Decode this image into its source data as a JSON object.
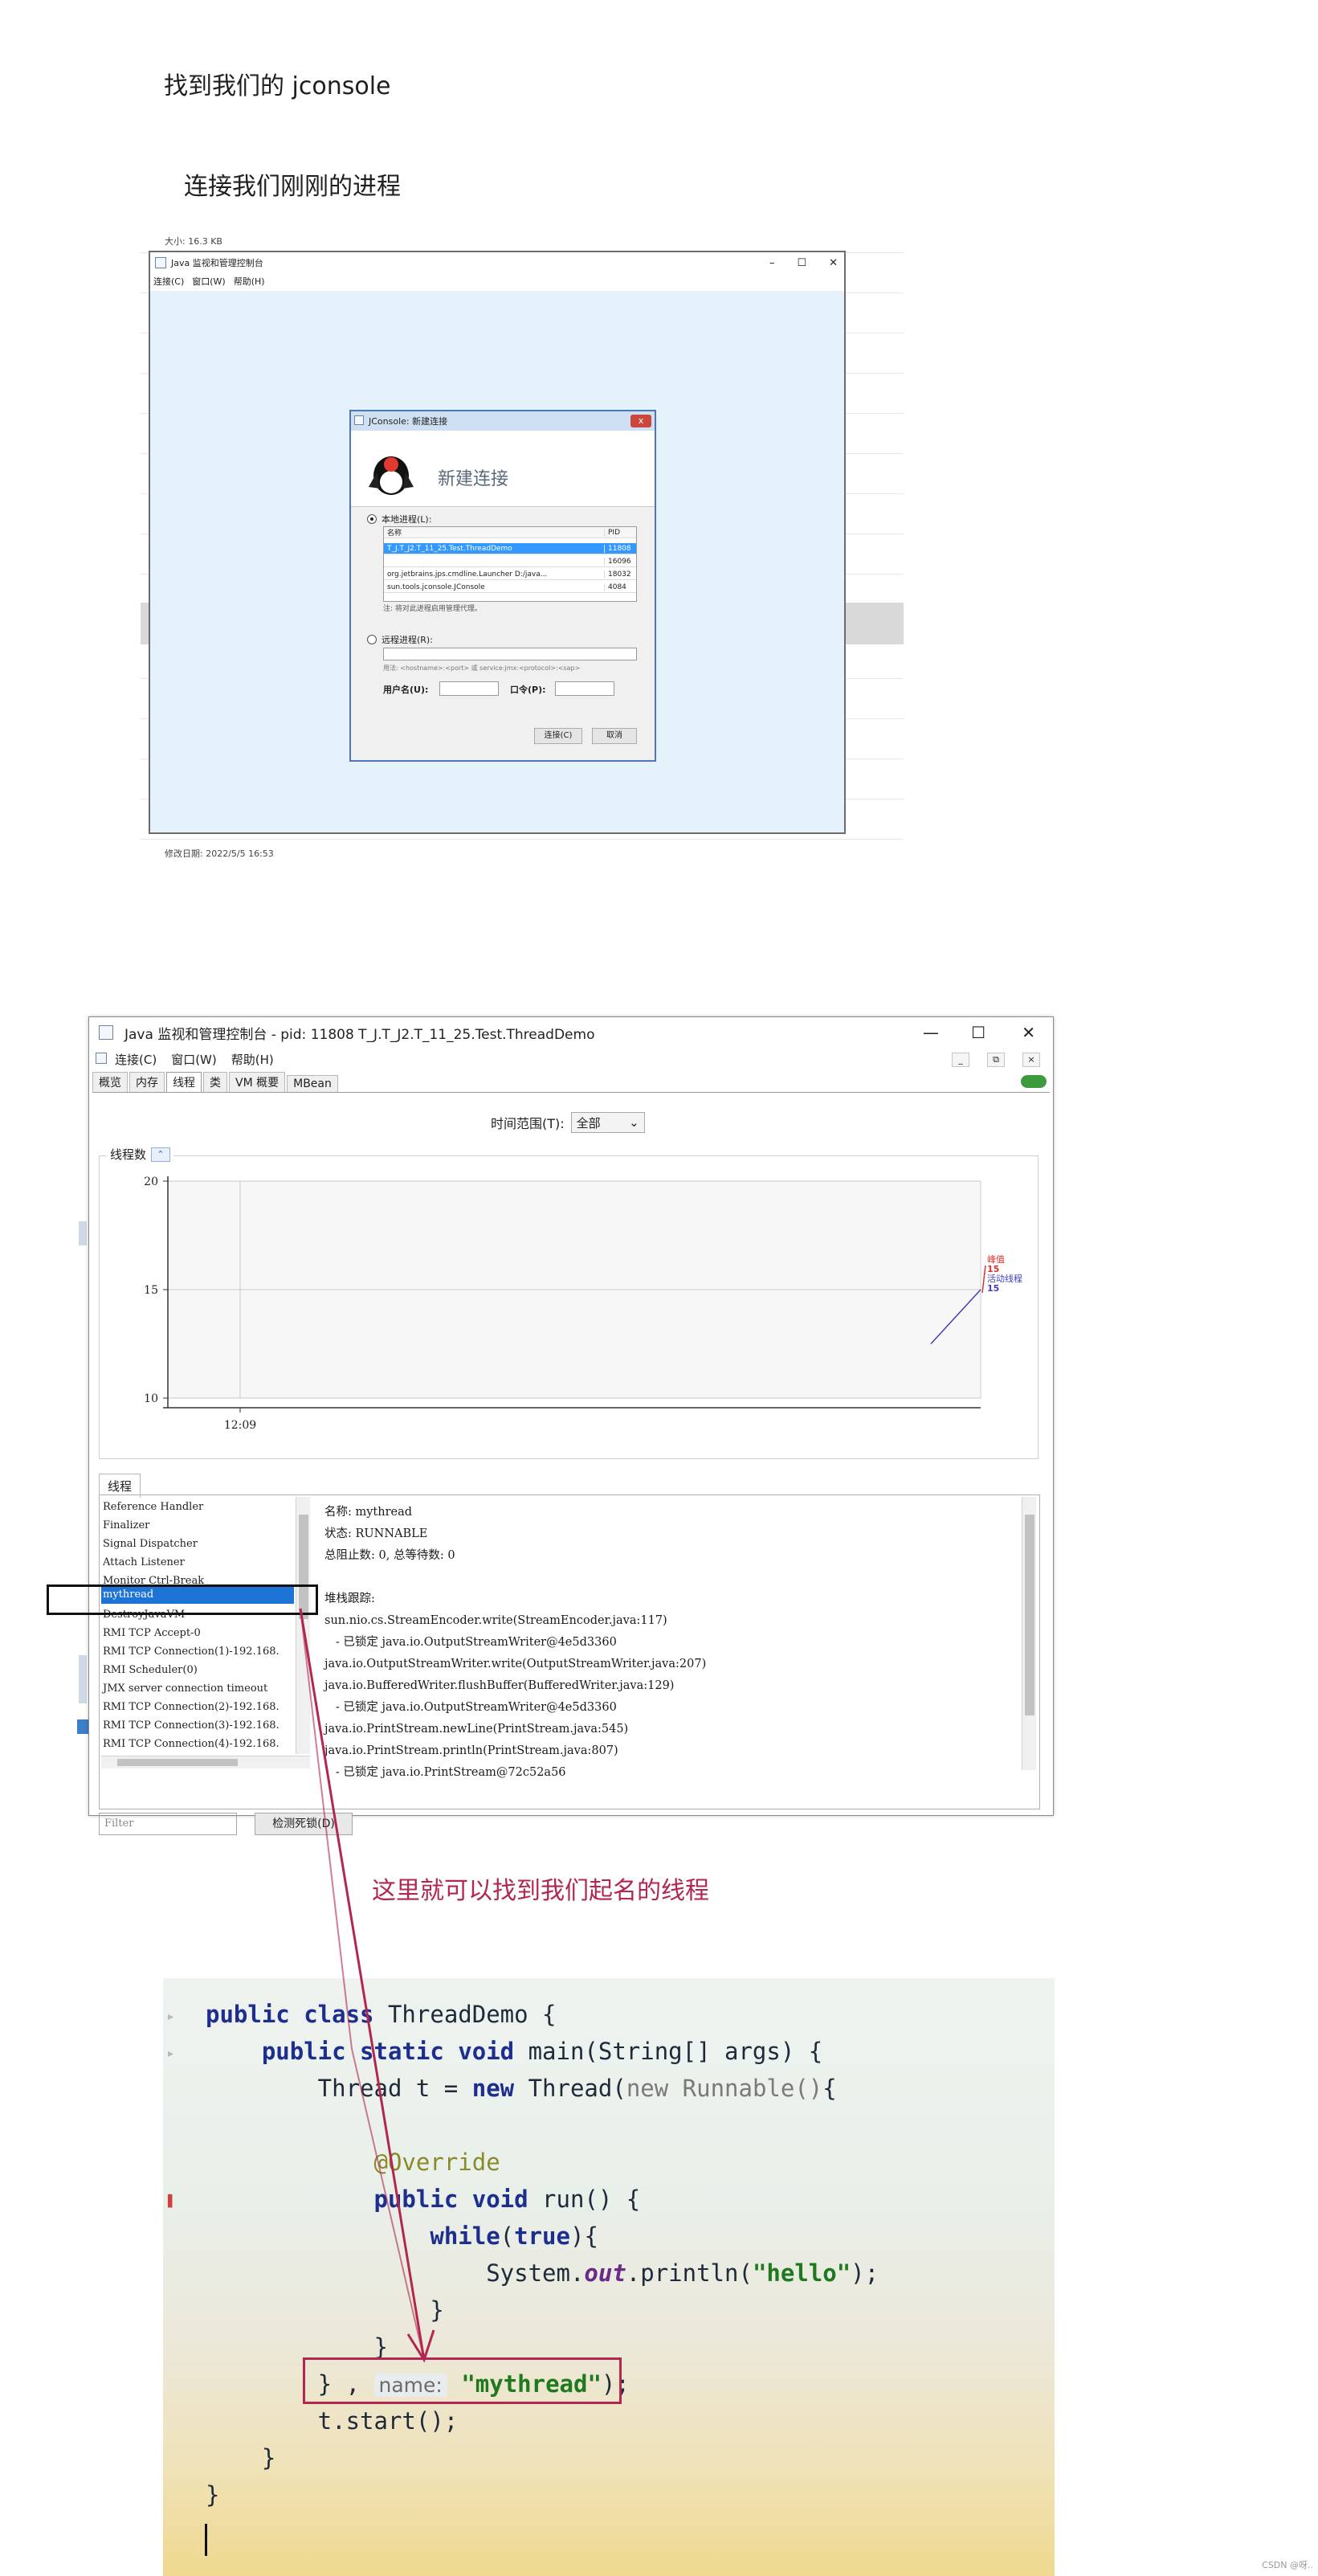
{
  "heading1": "找到我们的 jconsole",
  "heading2": "连接我们刚刚的进程",
  "shot1": {
    "size_text": "大小: 16.3 KB",
    "modified_text": "修改日期: 2022/5/5 16:53",
    "window_title": "Java 监视和管理控制台",
    "window_controls": [
      "–",
      "☐",
      "✕"
    ],
    "menu": [
      "连接(C)",
      "窗口(W)",
      "帮助(H)"
    ],
    "dialog": {
      "title": "JConsole: 新建连接",
      "close": "x",
      "header": "新建连接",
      "local_label": "本地进程(L):",
      "table_headers": [
        "名称",
        "PID"
      ],
      "processes": [
        {
          "name": "T_J.T_J2.T_11_25.Test.ThreadDemo",
          "pid": "11808"
        },
        {
          "name": "",
          "pid": "16096"
        },
        {
          "name": "org.jetbrains.jps.cmdline.Launcher D:/java...",
          "pid": "18032"
        },
        {
          "name": "sun.tools.jconsole.JConsole",
          "pid": "4084"
        }
      ],
      "note": "注: 将对此进程启用管理代理。",
      "remote_label": "远程进程(R):",
      "usage": "用法: <hostname>:<port> 或 service:jmx:<protocol>:<sap>",
      "username_label": "用户名(U):",
      "password_label": "口令(P):",
      "connect_btn": "连接(C)",
      "cancel_btn": "取消"
    }
  },
  "shot2": {
    "window_title": "Java 监视和管理控制台 - pid: 11808 T_J.T_J2.T_11_25.Test.ThreadDemo",
    "window_controls": [
      "—",
      "☐",
      "✕"
    ],
    "menu": [
      "连接(C)",
      "窗口(W)",
      "帮助(H)"
    ],
    "mini_controls": [
      "_",
      "⧉",
      "×"
    ],
    "tabs": [
      "概览",
      "内存",
      "线程",
      "类",
      "VM 概要",
      "MBean"
    ],
    "active_tab": "线程",
    "time_range_label": "时间范围(T):",
    "time_range_value": "全部",
    "chart_title": "线程数",
    "thread_tab": "线程",
    "threads": [
      "Reference Handler",
      "Finalizer",
      "Signal Dispatcher",
      "Attach Listener",
      "Monitor Ctrl-Break",
      "mythread",
      "DestroyJavaVM",
      "RMI TCP Accept-0",
      "RMI TCP Connection(1)-192.168.",
      "RMI Scheduler(0)",
      "JMX server connection timeout",
      "RMI TCP Connection(2)-192.168.",
      "RMI TCP Connection(3)-192.168.",
      "RMI TCP Connection(4)-192.168."
    ],
    "selected_thread": "mythread",
    "detail_lines": [
      "名称: mythread",
      "状态: RUNNABLE",
      "总阻止数: 0, 总等待数: 0",
      "",
      "堆栈跟踪:",
      "sun.nio.cs.StreamEncoder.write(StreamEncoder.java:117)",
      "   - 已锁定 java.io.OutputStreamWriter@4e5d3360",
      "java.io.OutputStreamWriter.write(OutputStreamWriter.java:207)",
      "java.io.BufferedWriter.flushBuffer(BufferedWriter.java:129)",
      "   - 已锁定 java.io.OutputStreamWriter@4e5d3360",
      "java.io.PrintStream.newLine(PrintStream.java:545)",
      "java.io.PrintStream.println(PrintStream.java:807)",
      "   - 已锁定 java.io.PrintStream@72c52a56"
    ],
    "filter_placeholder": "Filter",
    "deadlock_btn": "检测死锁(D)"
  },
  "chart_data": {
    "type": "line",
    "title": "线程数",
    "xlabel": "",
    "ylabel": "",
    "x_ticks": [
      "12:09"
    ],
    "y_ticks": [
      10,
      15,
      20
    ],
    "ylim": [
      10,
      20
    ],
    "grid": true,
    "legend": [
      {
        "name": "峰值",
        "value": 15,
        "color": "#e03030"
      },
      {
        "name": "活动线程",
        "value": 15,
        "color": "#4040c0"
      }
    ],
    "series": [
      {
        "name": "活动线程",
        "points": [
          [
            0.0,
            12.5
          ],
          [
            1.0,
            15
          ]
        ]
      }
    ]
  },
  "annotation": "这里就可以找到我们起名的线程",
  "code": {
    "hint_label": "name:",
    "hint_value": "\"mythread\""
  },
  "watermark": "CSDN @呀..",
  "colors": {
    "annotation": "#b2274f",
    "selection": "#1d73d6",
    "peak": "#e03030",
    "active": "#4040c0"
  }
}
